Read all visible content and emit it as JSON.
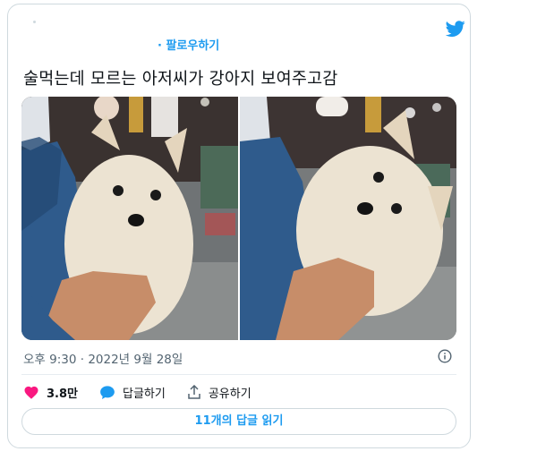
{
  "tweet": {
    "follow_label": "· 팔로우하기",
    "text": "술먹는데 모르는 아저씨가 강아지 보여주고감",
    "timestamp": "오후 9:30 · 2022년 9월 28일",
    "icons": {
      "brand": "twitter-bird-icon",
      "info": "info-icon"
    }
  },
  "actions": {
    "like_count": "3.8만",
    "reply_label": "답글하기",
    "share_label": "공유하기"
  },
  "replies_button": "11개의 답글 읽기",
  "colors": {
    "accent": "#1d9bf0",
    "like": "#f91880",
    "muted": "#536471",
    "border": "#cfd9de"
  }
}
